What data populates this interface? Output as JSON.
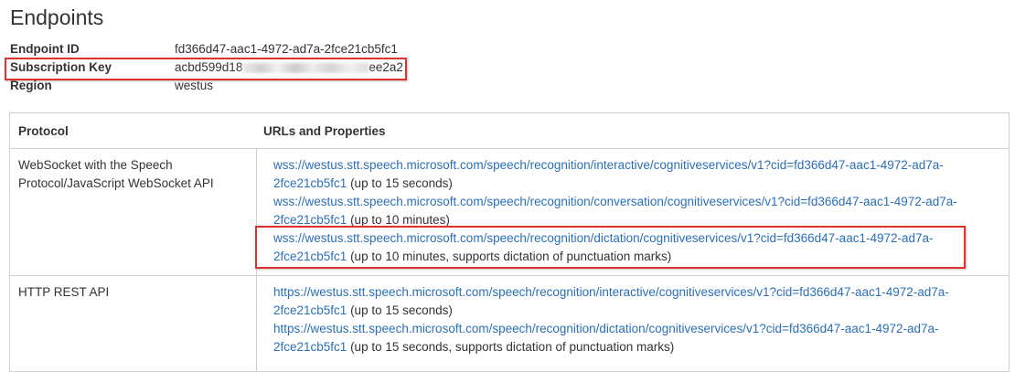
{
  "page": {
    "title": "Endpoints"
  },
  "properties": [
    {
      "label": "Endpoint ID",
      "value": "fd366d47-aac1-4972-ad7a-2fce21cb5fc1"
    },
    {
      "label": "Subscription Key",
      "value_start": "acbd599d18",
      "value_end": "ee2a2"
    },
    {
      "label": "Region",
      "value": "westus"
    }
  ],
  "table": {
    "headers": {
      "protocol": "Protocol",
      "urls": "URLs and Properties"
    },
    "rows": [
      {
        "protocol": "WebSocket with the Speech Protocol/JavaScript WebSocket API",
        "entries": [
          {
            "url_line1": "wss://westus.stt.speech.microsoft.com/speech/recognition/interactive/cognitiveservices/v1?cid=fd366d47-aac1-4972-ad7a-",
            "url_line2": "2fce21cb5fc1",
            "note": " (up to 15 seconds)"
          },
          {
            "url_line1": "wss://westus.stt.speech.microsoft.com/speech/recognition/conversation/cognitiveservices/v1?cid=fd366d47-aac1-4972-ad7a-",
            "url_line2": "2fce21cb5fc1",
            "note": " (up to 10 minutes)"
          },
          {
            "url_line1": "wss://westus.stt.speech.microsoft.com/speech/recognition/dictation/cognitiveservices/v1?cid=fd366d47-aac1-4972-ad7a-",
            "url_line2": "2fce21cb5fc1",
            "note": " (up to 10 minutes, supports dictation of punctuation marks)"
          }
        ]
      },
      {
        "protocol": "HTTP REST API",
        "entries": [
          {
            "url_line1": "https://westus.stt.speech.microsoft.com/speech/recognition/interactive/cognitiveservices/v1?cid=fd366d47-aac1-4972-ad7a-",
            "url_line2": "2fce21cb5fc1",
            "note": " (up to 15 seconds)"
          },
          {
            "url_line1": "https://westus.stt.speech.microsoft.com/speech/recognition/dictation/cognitiveservices/v1?cid=fd366d47-aac1-4972-ad7a-",
            "url_line2": "2fce21cb5fc1",
            "note": " (up to 15 seconds, supports dictation of punctuation marks)"
          }
        ]
      }
    ]
  },
  "colors": {
    "link": "#2b6fb6",
    "highlight": "#e0312f",
    "border": "#d0d0d0",
    "text": "#333333"
  }
}
